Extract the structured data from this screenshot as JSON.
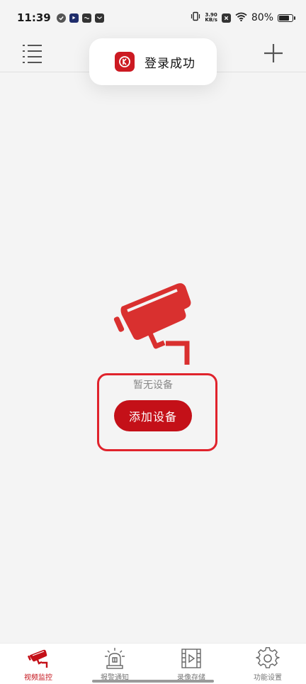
{
  "status_bar": {
    "time": "11:39",
    "net_speed_value": "3.90",
    "net_speed_unit": "KB/s",
    "battery": "80%",
    "battery_level": 0.8
  },
  "app_bar": {
    "menu_icon": "list-menu-icon",
    "add_icon": "plus-icon"
  },
  "toast": {
    "message": "登录成功",
    "logo_icon": "app-logo-icon"
  },
  "empty_state": {
    "illustration_icon": "security-camera-icon",
    "message": "暂无设备",
    "add_button_label": "添加设备"
  },
  "tabs": [
    {
      "label": "视频监控",
      "icon": "security-camera-icon",
      "active": true
    },
    {
      "label": "报警通知",
      "icon": "alarm-siren-icon",
      "active": false
    },
    {
      "label": "录像存储",
      "icon": "film-video-icon",
      "active": false
    },
    {
      "label": "功能设置",
      "icon": "gear-icon",
      "active": false
    }
  ],
  "colors": {
    "accent": "#c41018",
    "highlight": "#e0232c",
    "background": "#f4f4f4"
  }
}
